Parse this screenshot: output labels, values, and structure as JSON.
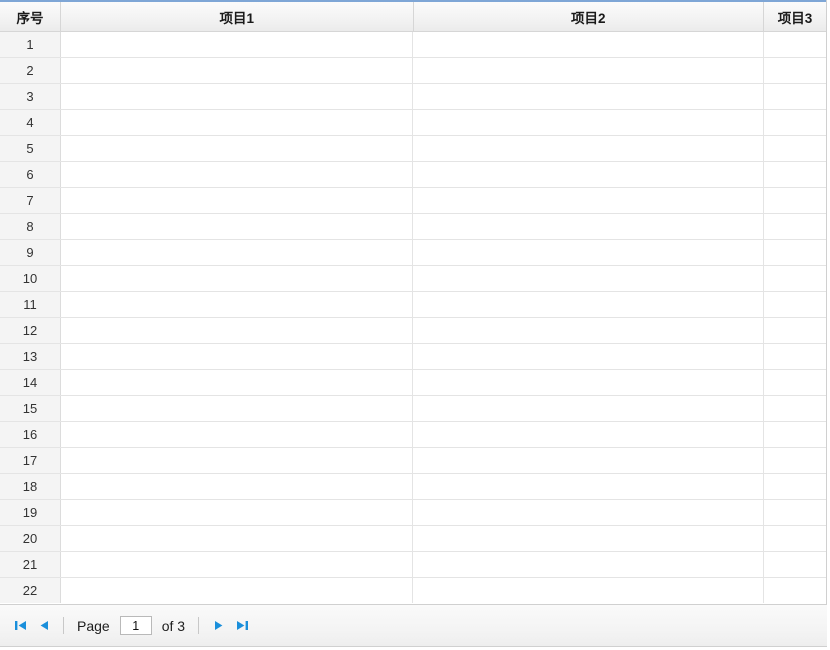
{
  "grid": {
    "columns": [
      {
        "key": "index",
        "label": "序号",
        "name": "column-header-index"
      },
      {
        "key": "item1",
        "label": "项目1",
        "name": "column-header-item1"
      },
      {
        "key": "item2",
        "label": "项目2",
        "name": "column-header-item2"
      },
      {
        "key": "item3",
        "label": "项目3",
        "name": "column-header-item3"
      }
    ],
    "rows": [
      {
        "index": "1",
        "item1": "",
        "item2": "",
        "item3": ""
      },
      {
        "index": "2",
        "item1": "",
        "item2": "",
        "item3": ""
      },
      {
        "index": "3",
        "item1": "",
        "item2": "",
        "item3": ""
      },
      {
        "index": "4",
        "item1": "",
        "item2": "",
        "item3": ""
      },
      {
        "index": "5",
        "item1": "",
        "item2": "",
        "item3": ""
      },
      {
        "index": "6",
        "item1": "",
        "item2": "",
        "item3": ""
      },
      {
        "index": "7",
        "item1": "",
        "item2": "",
        "item3": ""
      },
      {
        "index": "8",
        "item1": "",
        "item2": "",
        "item3": ""
      },
      {
        "index": "9",
        "item1": "",
        "item2": "",
        "item3": ""
      },
      {
        "index": "10",
        "item1": "",
        "item2": "",
        "item3": ""
      },
      {
        "index": "11",
        "item1": "",
        "item2": "",
        "item3": ""
      },
      {
        "index": "12",
        "item1": "",
        "item2": "",
        "item3": ""
      },
      {
        "index": "13",
        "item1": "",
        "item2": "",
        "item3": ""
      },
      {
        "index": "14",
        "item1": "",
        "item2": "",
        "item3": ""
      },
      {
        "index": "15",
        "item1": "",
        "item2": "",
        "item3": ""
      },
      {
        "index": "16",
        "item1": "",
        "item2": "",
        "item3": ""
      },
      {
        "index": "17",
        "item1": "",
        "item2": "",
        "item3": ""
      },
      {
        "index": "18",
        "item1": "",
        "item2": "",
        "item3": ""
      },
      {
        "index": "19",
        "item1": "",
        "item2": "",
        "item3": ""
      },
      {
        "index": "20",
        "item1": "",
        "item2": "",
        "item3": ""
      },
      {
        "index": "21",
        "item1": "",
        "item2": "",
        "item3": ""
      },
      {
        "index": "22",
        "item1": "",
        "item2": "",
        "item3": ""
      }
    ]
  },
  "pager": {
    "first_icon": "first-page-icon",
    "prev_icon": "prev-page-icon",
    "next_icon": "next-page-icon",
    "last_icon": "last-page-icon",
    "page_label": "Page",
    "page_value": "1",
    "of_label": "of 3",
    "total_pages": "3",
    "icon_color": "#1a8fdb"
  },
  "theme": {
    "header_accent": "#7ea6d6",
    "header_text": "#1a1a1a",
    "grid_line": "#e4e4e4",
    "index_bg": "#f4f4f4"
  }
}
